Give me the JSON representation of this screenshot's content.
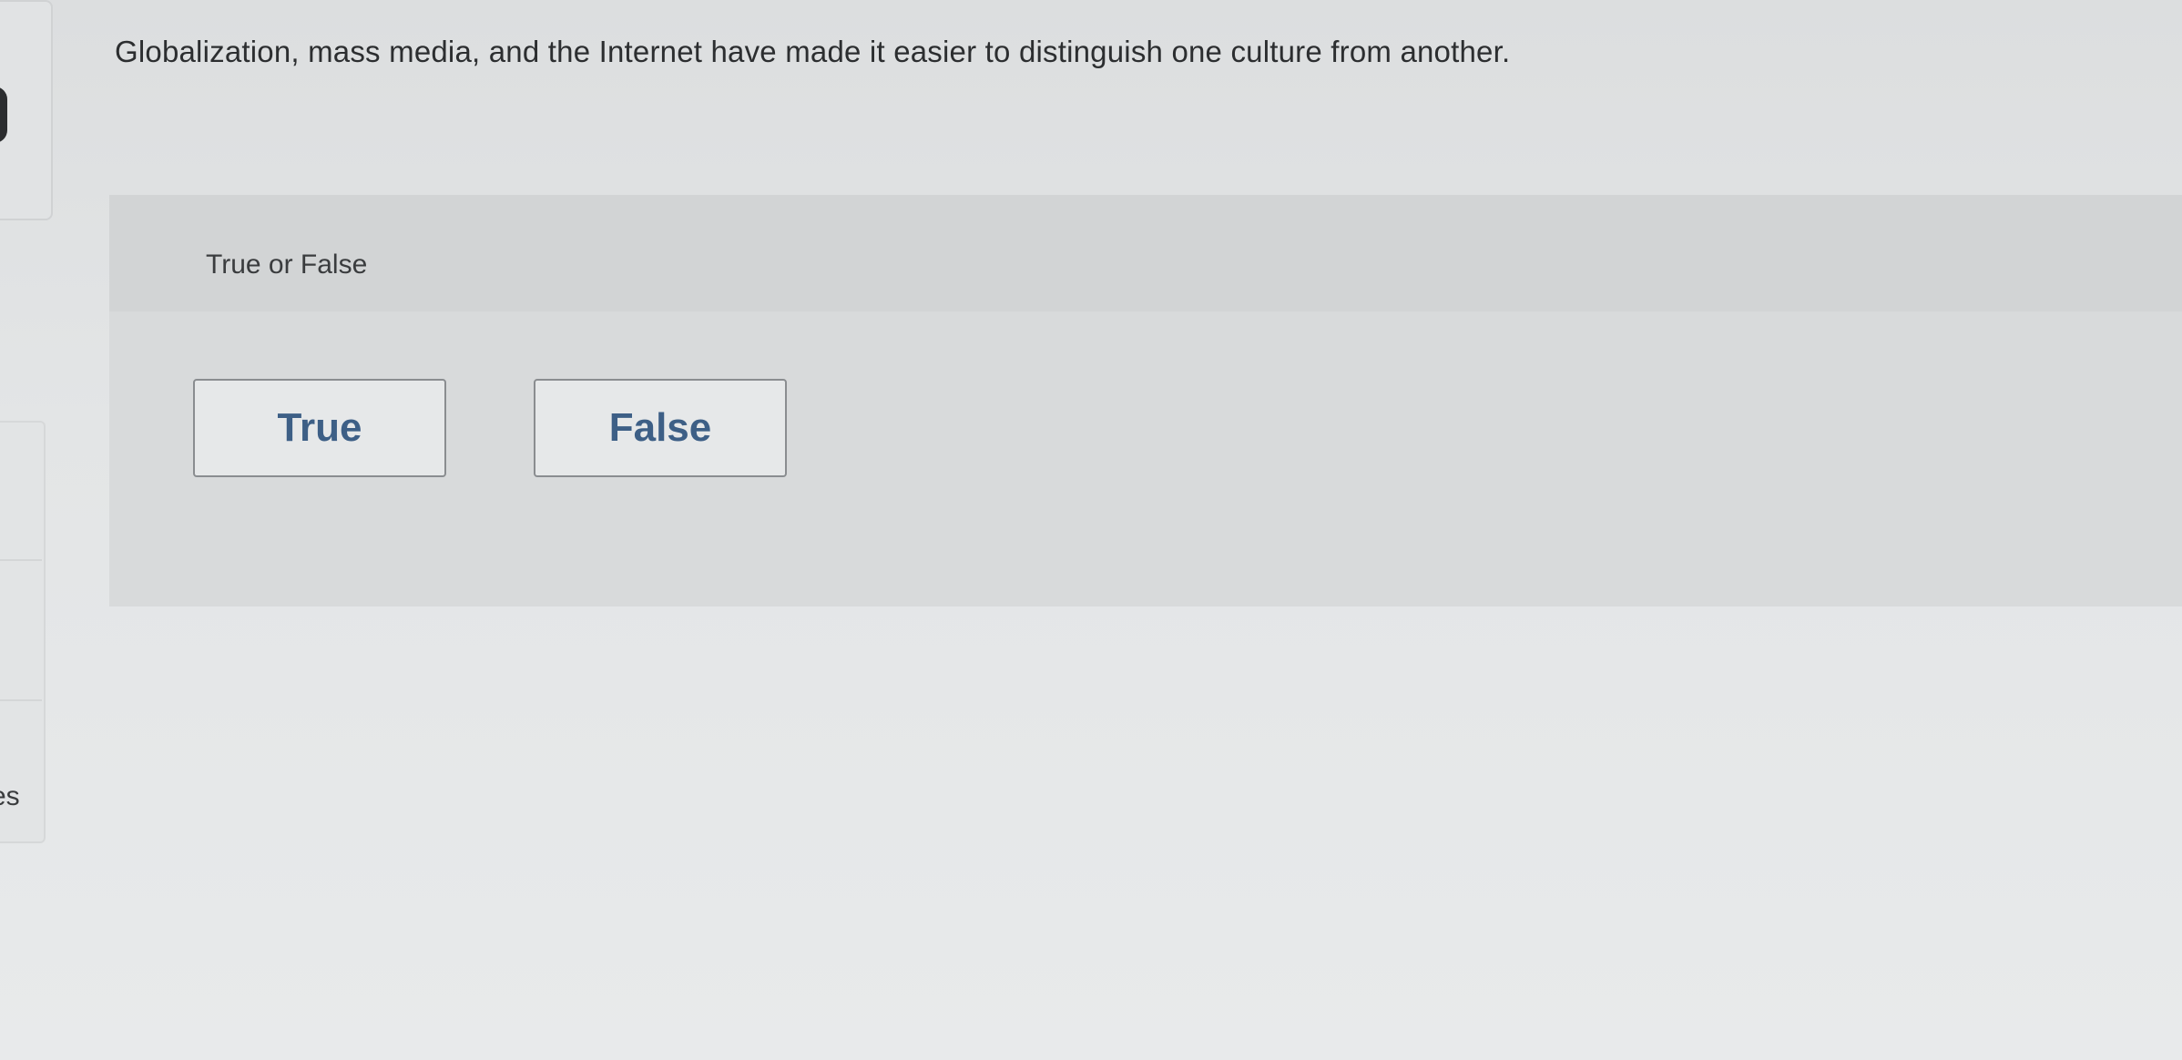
{
  "question": {
    "text": "Globalization, mass media, and the Internet have made it easier to distinguish one culture from another."
  },
  "answer_panel": {
    "type_label": "True or False",
    "choices": [
      {
        "label": "True"
      },
      {
        "label": "False"
      }
    ]
  },
  "sidebar": {
    "partial_label": "es"
  }
}
